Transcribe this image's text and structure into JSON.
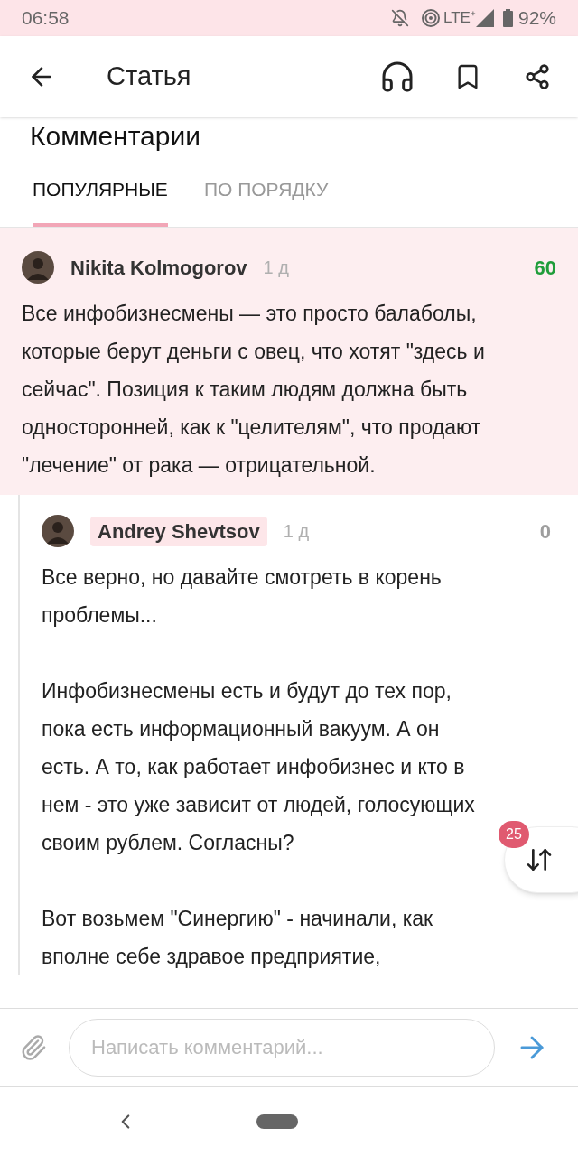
{
  "status_bar": {
    "time": "06:58",
    "network": "LTE⁺",
    "battery": "92%"
  },
  "app_bar": {
    "title": "Статья"
  },
  "section_title": "Комментарии",
  "tabs": [
    {
      "label": "ПОПУЛЯРНЫЕ",
      "selected": true
    },
    {
      "label": "ПО ПОРЯДКУ",
      "selected": false
    }
  ],
  "comments": [
    {
      "author": "Nikita Kolmogorov",
      "author_highlighted": false,
      "time": "1 д",
      "score": "60",
      "color": "#1f9d3a",
      "highlighted": true,
      "reply": false,
      "paragraphs": [
        "Все инфобизнесмены — это просто балаболы, которые берут деньги с овец, что хотят \"здесь и сейчас\". Позиция к таким людям должна быть односторонней, как к \"целителям\", что продают \"лечение\" от рака — отрицательной."
      ]
    },
    {
      "author": "Andrey Shevtsov",
      "author_highlighted": true,
      "time": "1 д",
      "score": "0",
      "color": "#9e9e9e",
      "highlighted": false,
      "reply": true,
      "paragraphs": [
        "Все верно, но давайте смотреть в корень проблемы...",
        "Инфобизнесмены есть и будут до тех пор, пока есть информационный вакуум. А он есть. А то, как работает инфобизнес и кто в нем - это уже зависит от людей, голосующих своим рублем. Согласны?",
        "Вот возьмем \"Синергию\" - начинали, как вполне себе здравое предприятие,"
      ]
    }
  ],
  "jump_button": {
    "badge": "25"
  },
  "composer": {
    "placeholder": "Написать комментарий..."
  }
}
